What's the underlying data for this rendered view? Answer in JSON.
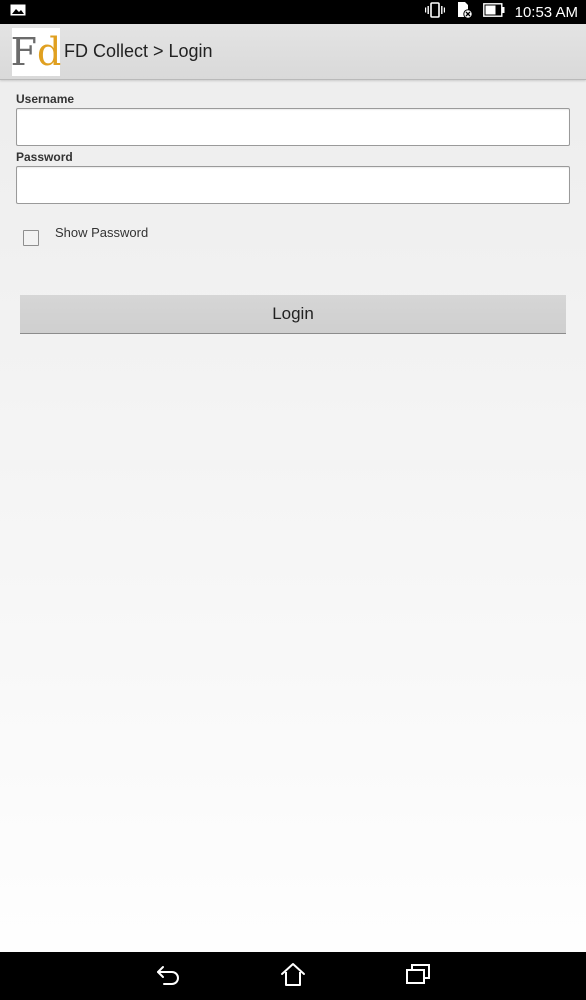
{
  "status_bar": {
    "time": "10:53 AM",
    "icons": [
      "image-notification-icon",
      "vibrate-icon",
      "sd-card-icon",
      "battery-icon"
    ]
  },
  "action_bar": {
    "logo_f": "F",
    "logo_d": "d",
    "title": "FD Collect > Login"
  },
  "form": {
    "username_label": "Username",
    "username_value": "",
    "password_label": "Password",
    "password_value": "",
    "show_password_label": "Show Password",
    "show_password_checked": false,
    "login_label": "Login"
  },
  "nav_bar": {
    "icons": [
      "back-icon",
      "home-icon",
      "recent-apps-icon"
    ]
  },
  "colors": {
    "status_bar_bg": "#000000",
    "action_bar_bg": "#dcdcdc",
    "button_bg": "#d3d3d3",
    "logo_accent": "#e0a020"
  }
}
